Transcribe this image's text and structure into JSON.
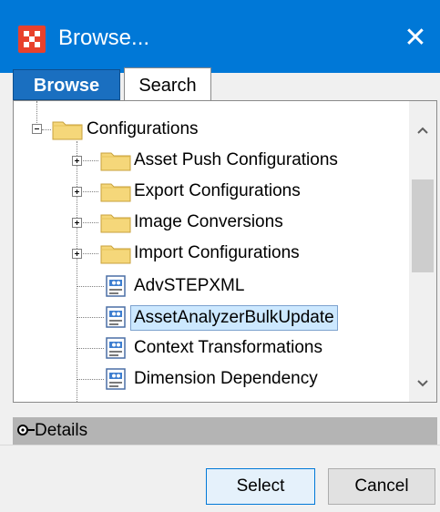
{
  "window": {
    "title": "Browse...",
    "close_glyph": "✕",
    "icon": "stibo-app-icon"
  },
  "tabs": [
    {
      "label": "Browse",
      "selected": true
    },
    {
      "label": "Search",
      "selected": false
    }
  ],
  "tree": {
    "root": {
      "label": "Configurations",
      "expanded": true,
      "icon": "folder-icon"
    },
    "children": [
      {
        "label": "Asset Push Configurations",
        "type": "folder",
        "expandable": true
      },
      {
        "label": "Export Configurations",
        "type": "folder",
        "expandable": true
      },
      {
        "label": "Image Conversions",
        "type": "folder",
        "expandable": true
      },
      {
        "label": "Import Configurations",
        "type": "folder",
        "expandable": true
      },
      {
        "label": "AdvSTEPXML",
        "type": "config",
        "expandable": false
      },
      {
        "label": "AssetAnalyzerBulkUpdate",
        "type": "config",
        "expandable": false,
        "selected": true
      },
      {
        "label": "Context Transformations",
        "type": "config",
        "expandable": false
      },
      {
        "label": "Dimension Dependency",
        "type": "config",
        "expandable": false
      }
    ]
  },
  "details": {
    "label": "Details",
    "icon": "expand-toggle-icon"
  },
  "buttons": {
    "select_label": "Select",
    "cancel_label": "Cancel"
  },
  "colors": {
    "titlebar": "#0078d7",
    "tab_selected": "#1a6fc0",
    "selection": "#cce8ff",
    "folder": "#f5d77a"
  }
}
